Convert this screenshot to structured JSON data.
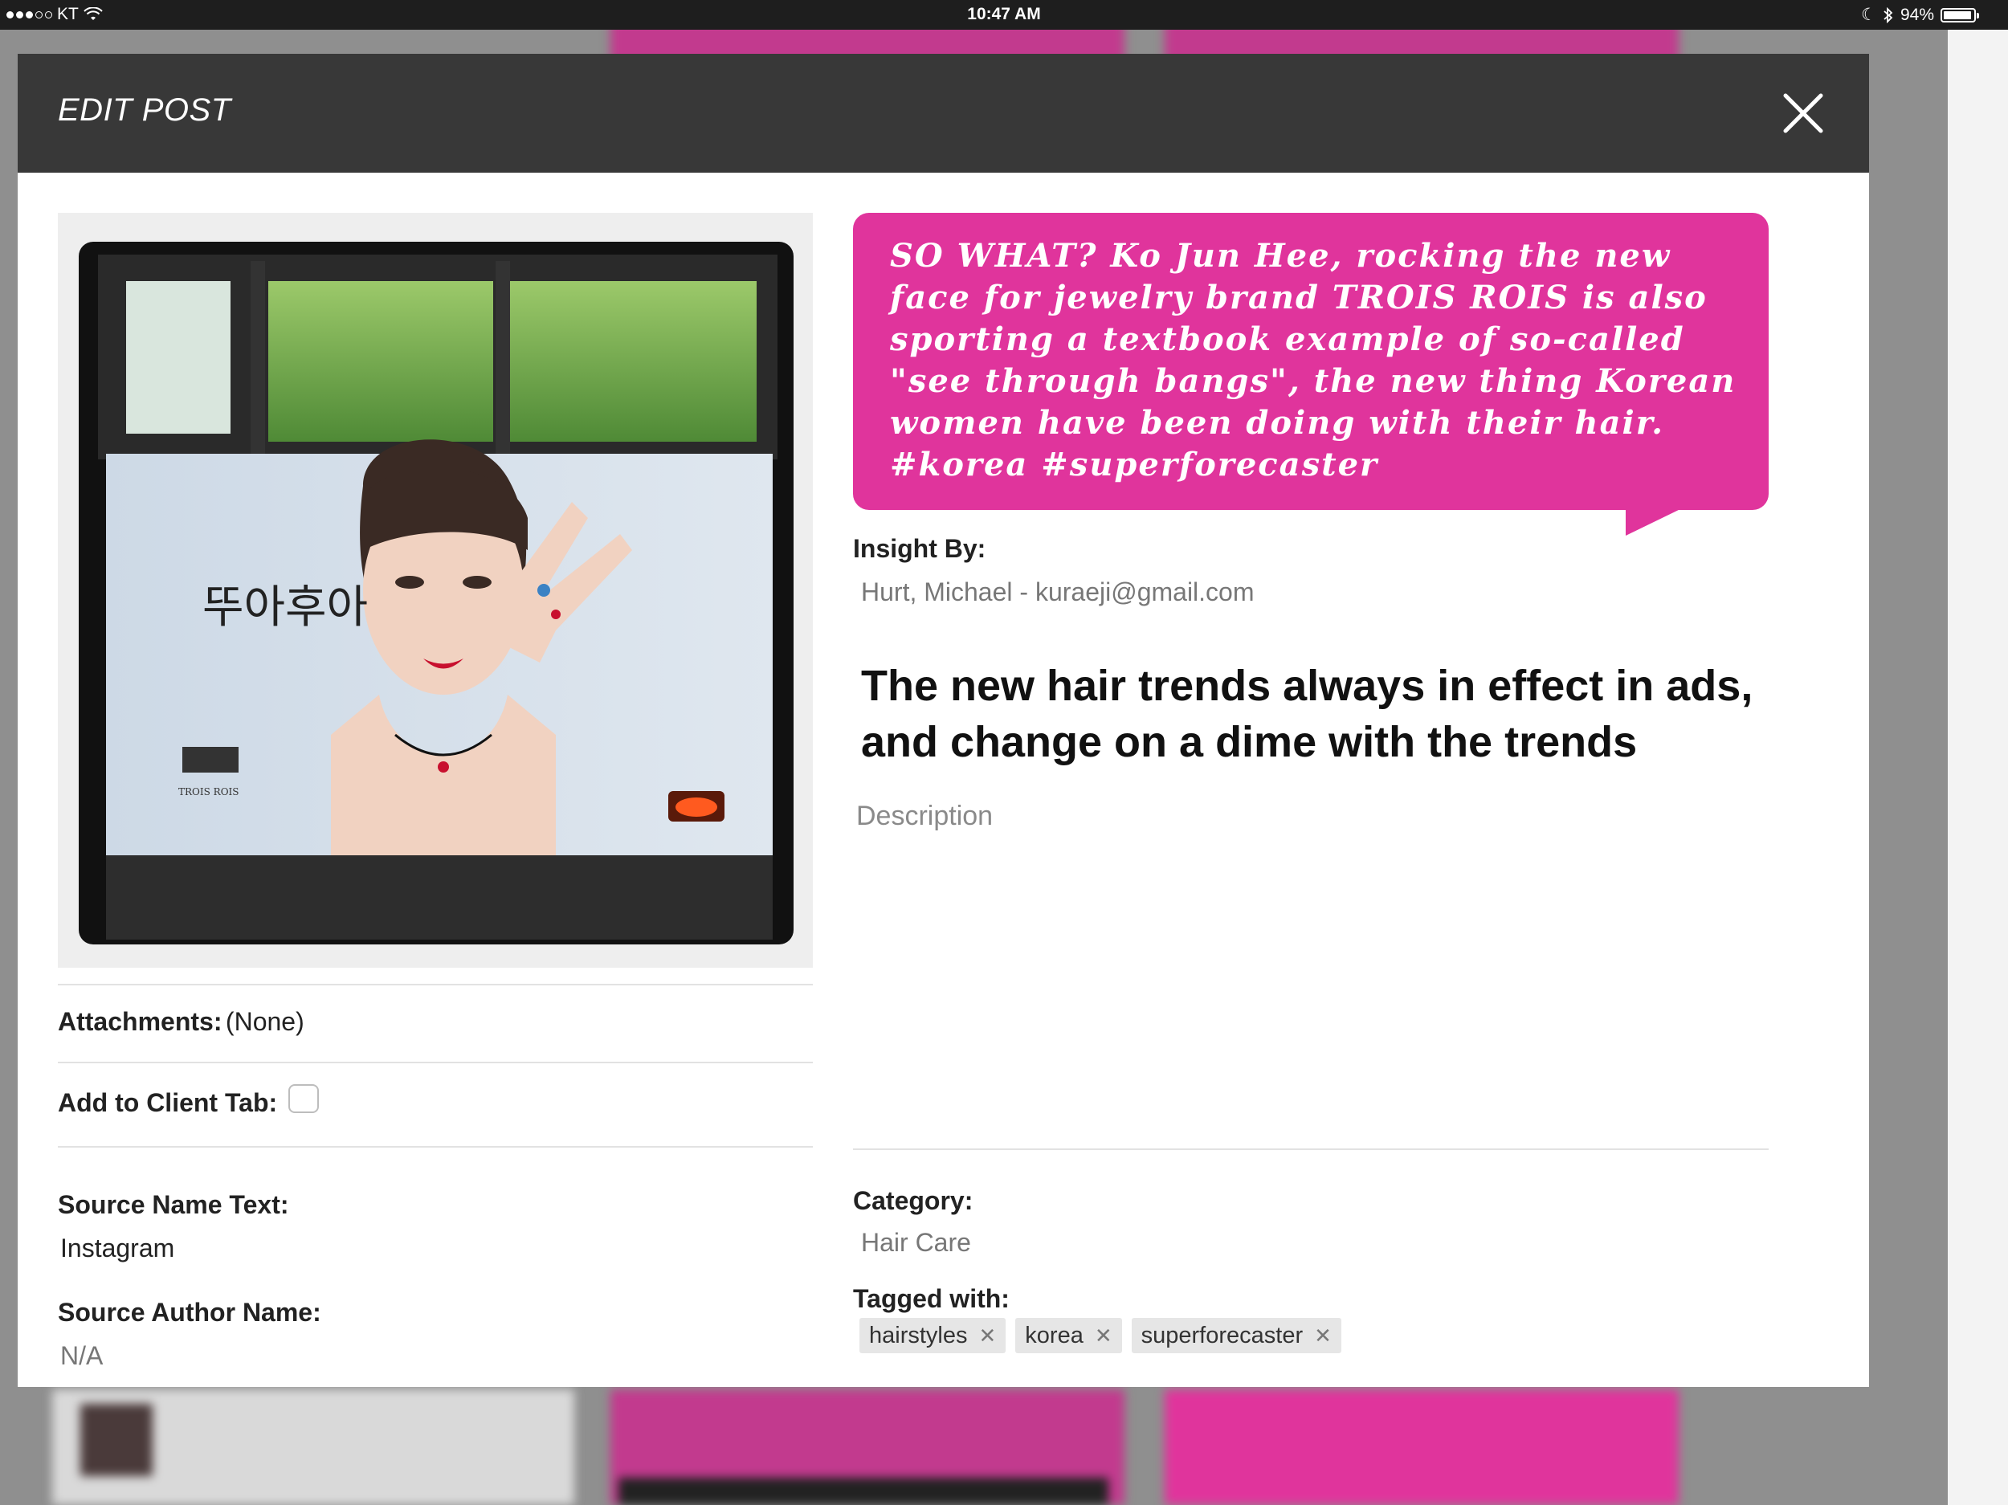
{
  "status_bar": {
    "carrier": "KT",
    "time": "10:47 AM",
    "battery": "94%",
    "battery_level": 0.94
  },
  "modal": {
    "title": "EDIT POST",
    "close_icon": "close-icon"
  },
  "bubble_text": "SO WHAT? Ko Jun Hee, rocking the new face for jewelry brand TROIS ROIS is also sporting a textbook example of so-called \"see through bangs\", the new thing Korean women have been doing with their hair. #korea #superforecaster",
  "insight": {
    "label": "Insight By:",
    "value": "Hurt, Michael - kuraeji@gmail.com"
  },
  "headline": "The new hair trends always in effect in ads, and change on a dime with the trends",
  "description": {
    "placeholder": "Description",
    "value": ""
  },
  "attachments": {
    "label": "Attachments:",
    "value": "(None)"
  },
  "client_tab": {
    "label": "Add to Client Tab:",
    "checked": false
  },
  "source_name": {
    "label": "Source Name Text:",
    "value": "Instagram"
  },
  "source_author": {
    "label": "Source Author Name:",
    "value": "N/A"
  },
  "category": {
    "label": "Category:",
    "value": "Hair Care"
  },
  "tagged": {
    "label": "Tagged with:",
    "tags": [
      "hairstyles",
      "korea",
      "superforecaster"
    ]
  },
  "photo": {
    "ad_text": "뚜아후아",
    "brand_text": "TROIS ROIS"
  },
  "colors": {
    "accent_pink": "#e0349c",
    "header_dark": "#383838"
  }
}
